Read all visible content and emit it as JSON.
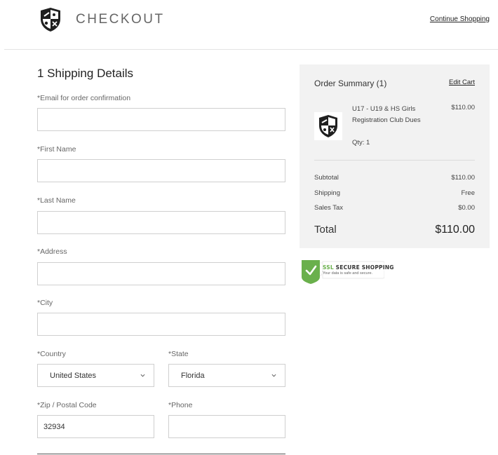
{
  "header": {
    "title": "CHECKOUT",
    "continue_label": "Continue Shopping",
    "logo_icon": "club-crest-icon"
  },
  "form": {
    "section_title": "1  Shipping Details",
    "email_label": "*Email for order confirmation",
    "email_value": "",
    "first_name_label": "*First Name",
    "first_name_value": "",
    "last_name_label": "*Last Name",
    "last_name_value": "",
    "address_label": "*Address",
    "address_value": "",
    "city_label": "*City",
    "city_value": "",
    "country_label": "*Country",
    "country_value": "United States",
    "state_label": "*State",
    "state_value": "Florida",
    "zip_label": "*Zip / Postal Code",
    "zip_value": "32934",
    "phone_label": "*Phone",
    "phone_value": ""
  },
  "summary": {
    "title": "Order Summary (1)",
    "edit_cart_label": "Edit Cart",
    "item": {
      "name": "U17 - U19 & HS Girls Registration Club Dues",
      "qty": "Qty: 1",
      "price": "$110.00"
    },
    "subtotal_label": "Subtotal",
    "subtotal_value": "$110.00",
    "shipping_label": "Shipping",
    "shipping_value": "Free",
    "tax_label": "Sales Tax",
    "tax_value": "$0.00",
    "total_label": "Total",
    "total_value": "$110.00"
  },
  "ssl": {
    "ssl_word": "SSL",
    "secure_text": "SECURE SHOPPING",
    "subtext": "Your data is safe and secure."
  },
  "colors": {
    "ssl_green": "#6ab04c",
    "summary_bg": "#f2f2f2",
    "border": "#cfcfcf"
  }
}
